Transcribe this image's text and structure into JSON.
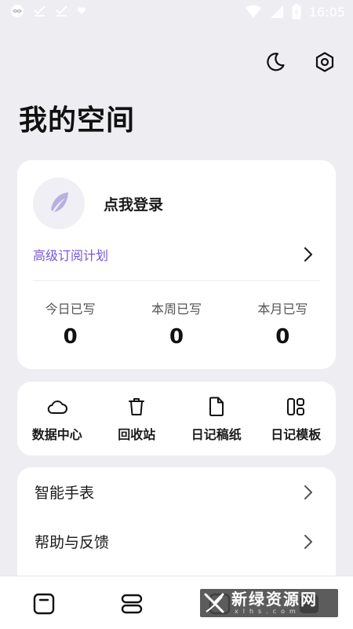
{
  "status_bar": {
    "time": "16:05"
  },
  "header": {
    "title": "我的空间",
    "night_mode_icon": "moon-icon",
    "settings_icon": "gear-icon"
  },
  "profile": {
    "login_label": "点我登录",
    "subscription_link": "高级订阅计划",
    "stats": [
      {
        "label": "今日已写",
        "value": "0"
      },
      {
        "label": "本周已写",
        "value": "0"
      },
      {
        "label": "本月已写",
        "value": "0"
      }
    ]
  },
  "quick_actions": [
    {
      "label": "数据中心",
      "icon": "cloud-icon"
    },
    {
      "label": "回收站",
      "icon": "trash-icon"
    },
    {
      "label": "日记稿纸",
      "icon": "document-icon"
    },
    {
      "label": "日记模板",
      "icon": "template-icon"
    }
  ],
  "menu": [
    {
      "label": "智能手表"
    },
    {
      "label": "帮助与反馈"
    }
  ],
  "watermark": {
    "title": "新绿资源网",
    "subtitle": "xlhs.com"
  },
  "colors": {
    "accent": "#7b55d8",
    "background": "#eeeef2",
    "card": "#ffffff"
  }
}
